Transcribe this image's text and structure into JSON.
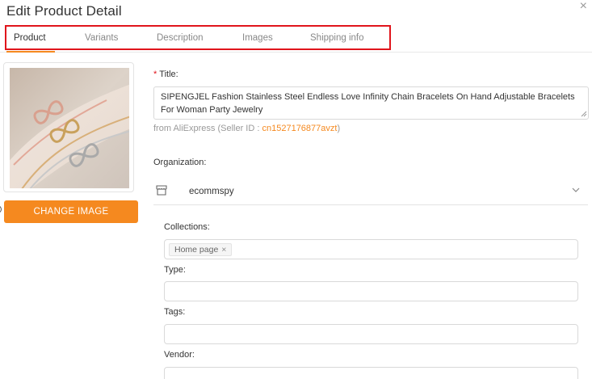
{
  "modal": {
    "title": "Edit Product Detail",
    "close_icon": "close-icon"
  },
  "tabs": [
    {
      "label": "Product",
      "active": true
    },
    {
      "label": "Variants",
      "active": false
    },
    {
      "label": "Description",
      "active": false
    },
    {
      "label": "Images",
      "active": false
    },
    {
      "label": "Shipping info",
      "active": false
    }
  ],
  "image_panel": {
    "image_alt": "product-photo-bracelets",
    "change_button": "CHANGE IMAGE"
  },
  "title_field": {
    "required_mark": "*",
    "label": "Title:",
    "value": "SIPENGJEL Fashion Stainless Steel Endless Love Infinity Chain Bracelets On Hand Adjustable Bracelets For Woman Party Jewelry"
  },
  "source": {
    "prefix": "from AliExpress (Seller ID : ",
    "seller_id": "cn1527176877avzt",
    "suffix": ")"
  },
  "organization": {
    "label": "Organization:",
    "store_name": "ecommspy",
    "icon": "store-icon"
  },
  "collections": {
    "label": "Collections:",
    "tags": [
      {
        "label": "Home page",
        "remove": "×"
      }
    ]
  },
  "type_field": {
    "label": "Type:",
    "value": ""
  },
  "tags_field": {
    "label": "Tags:",
    "value": ""
  },
  "vendor_field": {
    "label": "Vendor:",
    "value": ""
  },
  "colors": {
    "accent": "#f5891f",
    "highlight": "#e0151c",
    "border": "#d9d9d9"
  }
}
